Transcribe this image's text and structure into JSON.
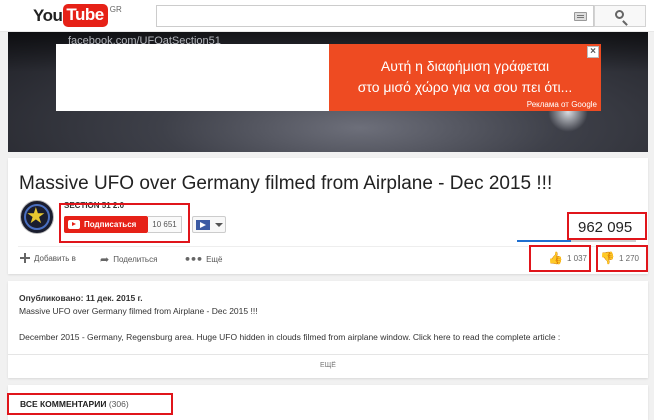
{
  "masthead": {
    "logo_you": "You",
    "logo_tube": "Tube",
    "logo_region": "GR",
    "search_placeholder": ""
  },
  "player": {
    "watermark": "facebook.com/UFOatSection51",
    "ad": {
      "line1": "Αυτή η διαφήμιση γράφεται",
      "line2": "στο μισό χώρο για να σου πει ότι...",
      "credit": "Реклама от Google",
      "close": "×"
    }
  },
  "video": {
    "title": "Massive UFO over Germany filmed from Airplane - Dec 2015 !!!",
    "channel": "SECTION 51 2.0",
    "subscribe_label": "Подписаться",
    "subscriber_count": "10 651",
    "views": "962 095",
    "like_ratio": 0.45,
    "actions": {
      "add_to": "Добавить в",
      "share": "Поделиться",
      "more": "Ещё"
    },
    "likes": "1 037",
    "dislikes": "1 270"
  },
  "description": {
    "published": "Опубликовано: 11 дек. 2015 г.",
    "line1": "Massive UFO over Germany filmed from Airplane - Dec 2015 !!!",
    "line2": "December 2015 - Germany, Regensburg area. Huge UFO hidden in clouds filmed from airplane window. Click here to read the complete article :",
    "show_more": "ЕЩЁ"
  },
  "comments": {
    "title": "ВСЕ КОММЕНТАРИИ",
    "count": "(306)"
  },
  "colors": {
    "brand_red": "#e62117",
    "highlight_red": "#e0151b",
    "ad_orange": "#ee4b22",
    "like_blue": "#1f6fd0"
  }
}
